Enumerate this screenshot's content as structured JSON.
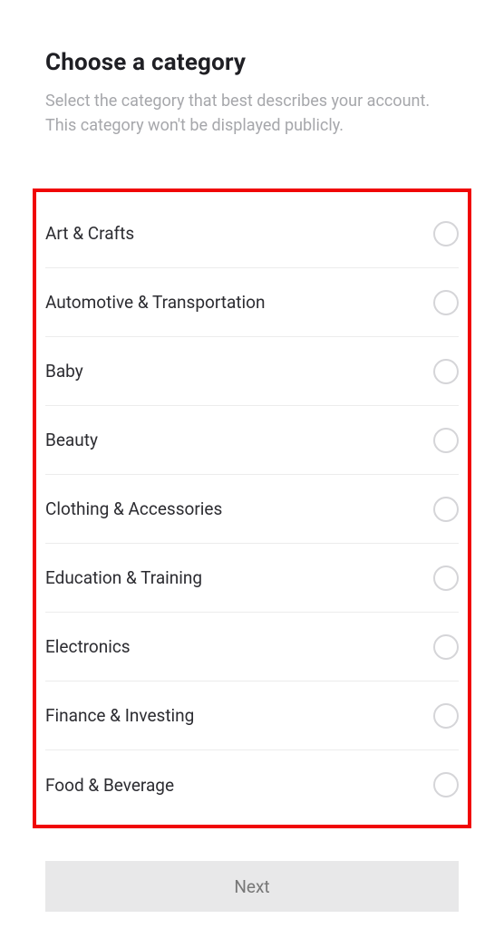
{
  "header": {
    "title": "Choose a category",
    "subtitle": "Select the category that best describes your account. This category won't be displayed publicly."
  },
  "categories": [
    {
      "label": "Art & Crafts"
    },
    {
      "label": "Automotive & Transportation"
    },
    {
      "label": "Baby"
    },
    {
      "label": "Beauty"
    },
    {
      "label": "Clothing & Accessories"
    },
    {
      "label": "Education & Training"
    },
    {
      "label": "Electronics"
    },
    {
      "label": "Finance & Investing"
    },
    {
      "label": "Food & Beverage"
    }
  ],
  "footer": {
    "next_label": "Next"
  }
}
